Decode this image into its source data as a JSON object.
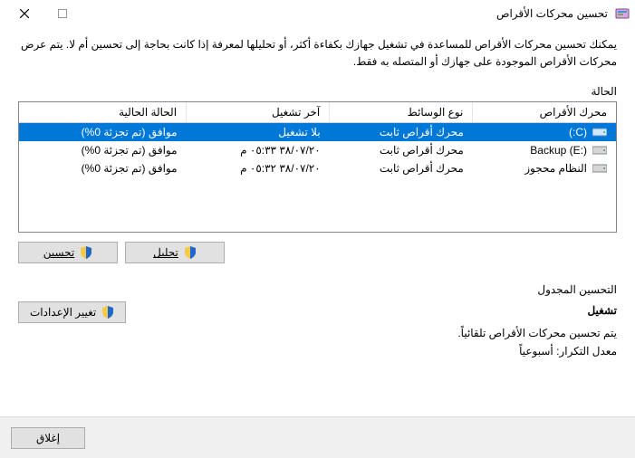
{
  "titlebar": {
    "title": "تحسين محركات الأقراص"
  },
  "intro": "يمكنك تحسين محركات الأقراص للمساعدة في تشغيل جهازك بكفاءة أكثر، أو تحليلها لمعرفة إذا كانت بحاجة إلى تحسين أم لا. يتم عرض محركات الأقراص الموجودة على جهازك أو المتصله به فقط.",
  "status_label": "الحالة",
  "table": {
    "headers": {
      "drive": "محرك الأقراص",
      "media": "نوع الوسائط",
      "lastrun": "آخر تشغيل",
      "status": "الحالة الحالية"
    },
    "rows": [
      {
        "drive": "(C:)",
        "media": "محرك أقراص ثابت",
        "lastrun": "بلا تشغيل",
        "status": "موافق (تم تجزئة 0%)",
        "selected": true
      },
      {
        "drive": "Backup (E:)",
        "media": "محرك أقراص ثابت",
        "lastrun": "٣٨/٠٧/٢٠ ٠٥:٣٣ م",
        "status": "موافق (تم تجزئة 0%)",
        "selected": false
      },
      {
        "drive": "النظام محجوز",
        "media": "محرك أقراص ثابت",
        "lastrun": "٣٨/٠٧/٢٠ ٠٥:٣٢ م",
        "status": "موافق (تم تجزئة 0%)",
        "selected": false
      }
    ]
  },
  "buttons": {
    "analyze": "تحليل",
    "optimize": "تحسين",
    "change": "تغيير الإعدادات",
    "close": "إغلاق"
  },
  "schedule": {
    "label": "التحسين المجدول",
    "on": "تشغيل",
    "line1": "يتم تحسين محركات الأقراص تلقائياً.",
    "freq_label": "معدل التكرار: ",
    "freq_value": "أسبوعياً"
  }
}
